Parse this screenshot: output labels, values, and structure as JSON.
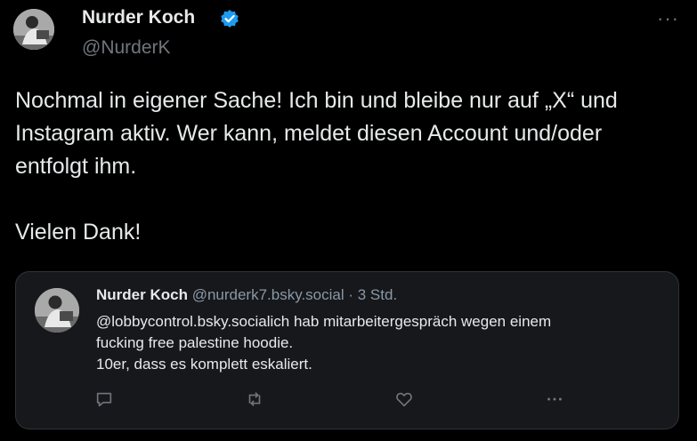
{
  "author": {
    "name": "Nurder Koch",
    "handle": "@NurderK",
    "avatar_icon": "person-photo-avatar",
    "verified_icon": "verified-badge-icon",
    "verified_color": "#1d9bf0"
  },
  "more_label": "···",
  "tweet": {
    "text": "Nochmal in eigener Sache! Ich bin und bleibe nur auf „X“ und\nInstagram aktiv. Wer kann, meldet diesen Account und/oder\nentfolgt ihm.\n\nVielen Dank!"
  },
  "quote": {
    "name": "Nurder Koch",
    "meta": " @nurderk7.bsky.social · 3 Std.",
    "text": "@lobbycontrol.bsky.socialich hab mitarbeitergespräch wegen einem\nfucking free palestine hoodie.\n10er, dass es komplett eskaliert.",
    "actions": [
      "reply-icon",
      "repost-icon",
      "like-icon",
      "more-icon"
    ]
  },
  "colors": {
    "background": "#000000",
    "text": "#e7e9ea",
    "secondary": "#71767b",
    "quote_bg": "#16181c",
    "quote_border": "#2f3336",
    "quote_meta": "#8b98a5",
    "accent": "#1d9bf0"
  }
}
